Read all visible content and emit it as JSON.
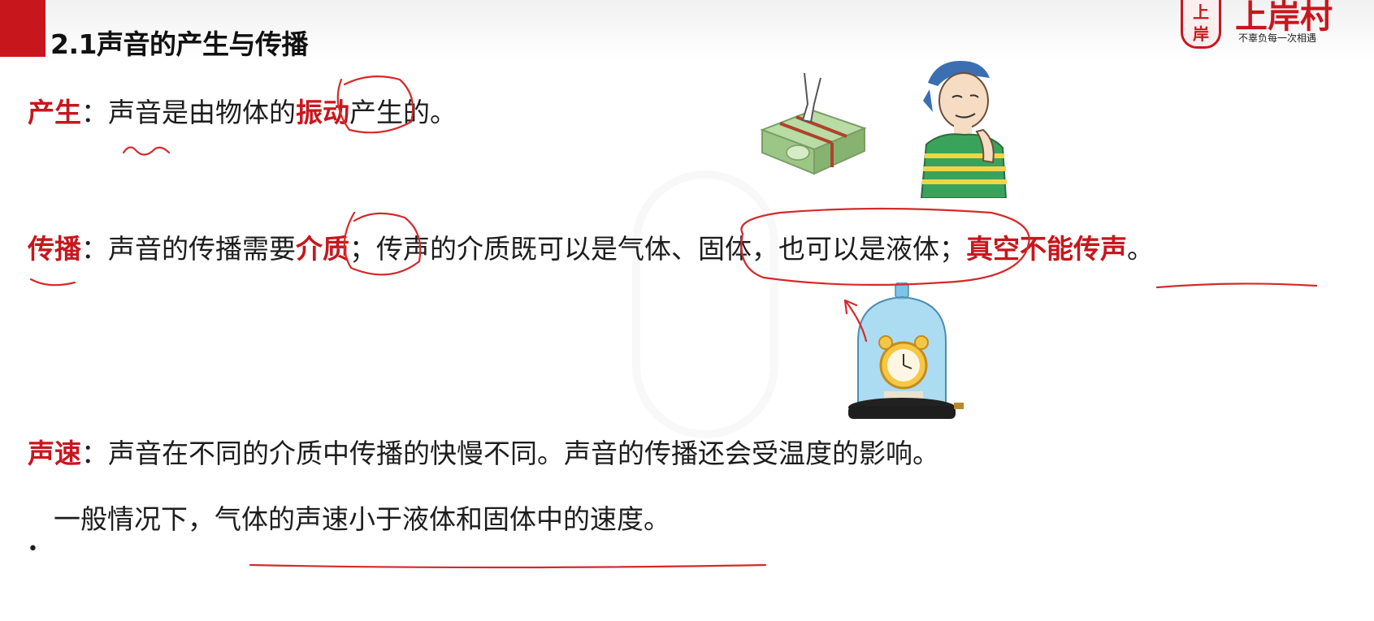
{
  "header": {
    "title": "2.1声音的产生与传播",
    "logo_seal": "上岸村",
    "logo_name": "上岸村",
    "logo_slogan": "不辜负每一次相遇"
  },
  "lines": {
    "production": {
      "label": "产生",
      "sep": "：",
      "pre": "声音是由物体的",
      "key": "振动",
      "post": "产生的。"
    },
    "propagation": {
      "label": "传播",
      "sep": "：",
      "pre": "声音的传播需要",
      "key": "介质",
      "post": "；传声的介质既可以是气体、固体，也可以是液体；",
      "key2": "真空不能传声",
      "end": "。"
    },
    "speed": {
      "label": "声速",
      "sep": "：",
      "text": "声音在不同的介质中传播的快慢不同。声音的传播还会受温度的影响。"
    },
    "bullet": {
      "marker": "•",
      "pre": "一般情况下，",
      "underlined": "气体的声速小于液体和固体中的速度",
      "end": "。"
    }
  },
  "colors": {
    "accent": "#c8161d",
    "ink": "#d42a2a"
  },
  "illustrations": [
    "plucked-rubber-band-box",
    "boy-touching-throat",
    "alarm-clock-in-bell-jar"
  ]
}
